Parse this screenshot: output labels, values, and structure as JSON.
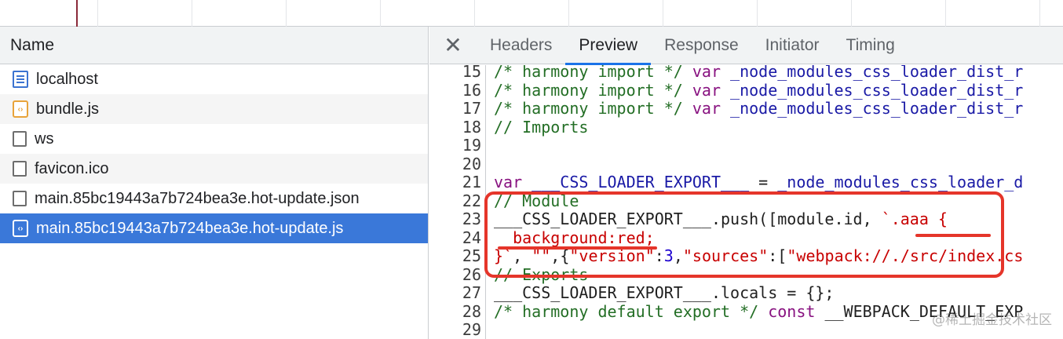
{
  "network": {
    "column_header": "Name",
    "requests": [
      {
        "name": "localhost",
        "icon": "document-icon"
      },
      {
        "name": "bundle.js",
        "icon": "script-icon"
      },
      {
        "name": "ws",
        "icon": "generic-file-icon"
      },
      {
        "name": "favicon.ico",
        "icon": "generic-file-icon"
      },
      {
        "name": "main.85bc19443a7b724bea3e.hot-update.json",
        "icon": "generic-file-icon"
      },
      {
        "name": "main.85bc19443a7b724bea3e.hot-update.js",
        "icon": "script-icon",
        "selected": true
      }
    ]
  },
  "detail": {
    "close_symbol": "✕",
    "tabs": [
      "Headers",
      "Preview",
      "Response",
      "Initiator",
      "Timing"
    ],
    "active_tab": "Preview"
  },
  "code": {
    "lines": [
      {
        "n": "15",
        "parts": [
          [
            "cm",
            "/* harmony import */ "
          ],
          [
            "kw",
            "var "
          ],
          [
            "vr",
            "_node_modules_css_loader_dist_r"
          ]
        ]
      },
      {
        "n": "16",
        "parts": [
          [
            "cm",
            "/* harmony import */ "
          ],
          [
            "kw",
            "var "
          ],
          [
            "vr",
            "_node_modules_css_loader_dist_r"
          ]
        ]
      },
      {
        "n": "17",
        "parts": [
          [
            "cm",
            "/* harmony import */ "
          ],
          [
            "kw",
            "var "
          ],
          [
            "vr",
            "_node_modules_css_loader_dist_r"
          ]
        ]
      },
      {
        "n": "18",
        "parts": [
          [
            "cm",
            "// Imports"
          ]
        ]
      },
      {
        "n": "19",
        "parts": []
      },
      {
        "n": "20",
        "parts": []
      },
      {
        "n": "21",
        "parts": [
          [
            "kw",
            "var "
          ],
          [
            "vr",
            "___CSS_LOADER_EXPORT___ "
          ],
          [
            "pl",
            "= "
          ],
          [
            "vr",
            "_node_modules_css_loader_d"
          ]
        ]
      },
      {
        "n": "22",
        "parts": [
          [
            "cm",
            "// Module"
          ]
        ]
      },
      {
        "n": "23",
        "parts": [
          [
            "pl",
            "___CSS_LOADER_EXPORT___.push([module.id, "
          ],
          [
            "st",
            "`.aaa {"
          ]
        ]
      },
      {
        "n": "24",
        "parts": [
          [
            "st",
            "  background:red;"
          ]
        ]
      },
      {
        "n": "25",
        "parts": [
          [
            "st",
            "}`"
          ],
          [
            "pl",
            ", "
          ],
          [
            "st",
            "\"\""
          ],
          [
            "pl",
            ",{"
          ],
          [
            "st",
            "\"version\""
          ],
          [
            "pl",
            ":"
          ],
          [
            "nm",
            "3"
          ],
          [
            "pl",
            ","
          ],
          [
            "st",
            "\"sources\""
          ],
          [
            "pl",
            ":["
          ],
          [
            "st",
            "\"webpack://./src/index.cs"
          ]
        ]
      },
      {
        "n": "26",
        "parts": [
          [
            "cm",
            "// Exports"
          ]
        ]
      },
      {
        "n": "27",
        "parts": [
          [
            "pl",
            "___CSS_LOADER_EXPORT___.locals = {};"
          ]
        ]
      },
      {
        "n": "28",
        "parts": [
          [
            "cm",
            "/* harmony default export */ "
          ],
          [
            "kw",
            "const "
          ],
          [
            "pl",
            "__WEBPACK_DEFAULT_EXP"
          ]
        ]
      },
      {
        "n": "29",
        "parts": []
      }
    ]
  },
  "watermark": "@稀土掘金技术社区",
  "colors": {
    "selected_row": "#3a78d9",
    "annotation": "#e5352a",
    "active_tab_underline": "#1a73e8"
  }
}
